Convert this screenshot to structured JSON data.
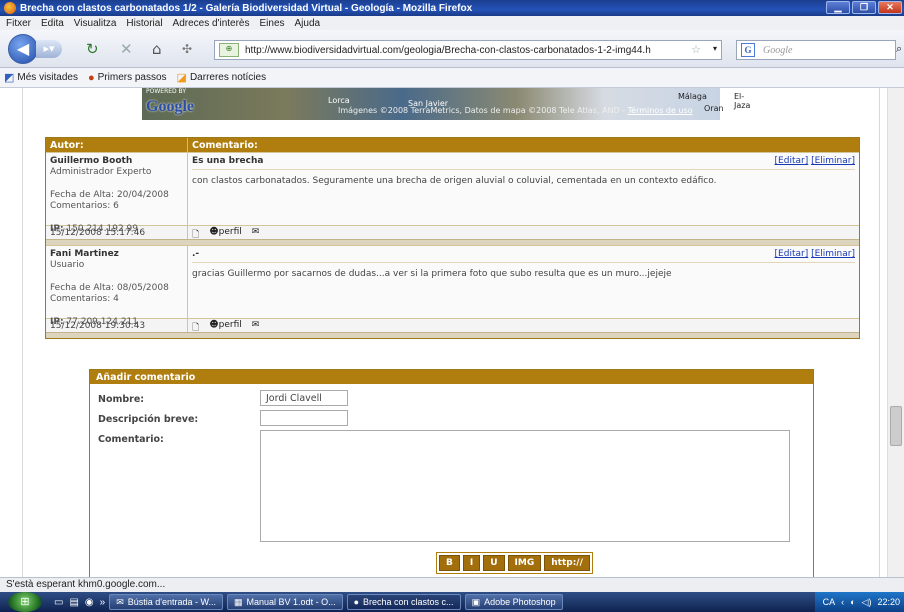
{
  "window": {
    "title": "Brecha con clastos carbonatados 1/2 - Galería Biodiversidad Virtual - Geología - Mozilla Firefox"
  },
  "menu": [
    "Fitxer",
    "Edita",
    "Visualitza",
    "Historial",
    "Adreces d'interès",
    "Eines",
    "Ajuda"
  ],
  "nav": {
    "url": "http://www.biodiversidadvirtual.com/geologia/Brecha-con-clastos-carbonatados-1-2-img44.h",
    "search_placeholder": "Google"
  },
  "bookmarks": [
    "Més visitades",
    "Primers passos",
    "Darreres notícies"
  ],
  "map": {
    "powered": "POWERED BY",
    "logo": "Google",
    "copyright": "Imágenes ©2008 TerraMetrics, Datos de mapa ©2008 Tele Atlas, AND - ",
    "terms": "Términos de uso",
    "labels": [
      "Lorca",
      "San Javier",
      "Málaga",
      "El-Jaza",
      "Oran"
    ]
  },
  "comments": {
    "header": {
      "author": "Autor:",
      "comment": "Comentario:"
    },
    "edit_label": "[Editar]",
    "delete_label": "[Eliminar]",
    "profile_label": "perfil",
    "items": [
      {
        "name": "Guillermo Booth",
        "role": "Administrador Experto",
        "joined": "Fecha de Alta: 20/04/2008",
        "count": "Comentarios: 6",
        "ip_label": "IP:",
        "ip": "150.214.192.99",
        "title": "Es una brecha",
        "text": "con clastos carbonatados. Seguramente una brecha de origen aluvial o coluvial, cementada en un contexto edáfico.",
        "date": "15/12/2008 15:17:46"
      },
      {
        "name": "Fani Martinez",
        "role": "Usuario",
        "joined": "Fecha de Alta: 08/05/2008",
        "count": "Comentarios: 4",
        "ip_label": "IP:",
        "ip": "77.209.124.211",
        "title": ".-",
        "text": "gracias Guillermo por sacarnos de dudas...a ver si la primera foto que subo resulta que es un muro...jejeje",
        "date": "15/12/2008 19:30:43"
      }
    ]
  },
  "form": {
    "title": "Añadir comentario",
    "name_label": "Nombre:",
    "name_value": "Jordi Clavell",
    "desc_label": "Descripción breve:",
    "desc_value": "",
    "comment_label": "Comentario:",
    "buttons": [
      "B",
      "I",
      "U",
      "IMG",
      "http://"
    ]
  },
  "status": "S'està esperant khm0.google.com...",
  "taskbar": {
    "tasks": [
      "Bústia d'entrada - W...",
      "Manual BV 1.odt - O...",
      "Brecha con clastos c...",
      "Adobe Photoshop"
    ],
    "lang": "CA",
    "time": "22:20"
  }
}
